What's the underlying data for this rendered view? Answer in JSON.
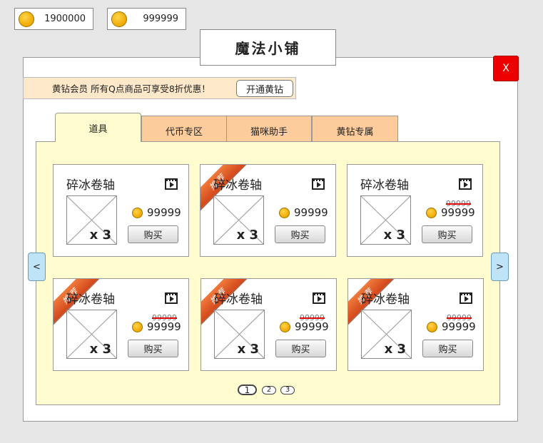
{
  "currency": [
    {
      "icon": "coin-icon",
      "amount": "1900000"
    },
    {
      "icon": "coin-icon",
      "amount": "999999"
    }
  ],
  "title": "魔法小铺",
  "close_label": "X",
  "vip_banner": {
    "text": "黄钻会员 所有Q点商品可享受8折优惠！",
    "button_label": "开通黄钻"
  },
  "tabs": [
    {
      "label": "道具",
      "active": true
    },
    {
      "label": "代币专区",
      "active": false
    },
    {
      "label": "猫咪助手",
      "active": false
    },
    {
      "label": "黄钻专属",
      "active": false
    }
  ],
  "items": [
    {
      "name": "碎冰卷轴",
      "quantity": "x 3",
      "price": "99999",
      "old_price": "",
      "badge": "",
      "buy_label": "购买"
    },
    {
      "name": "碎冰卷轴",
      "quantity": "x 3",
      "price": "99999",
      "old_price": "",
      "badge": "推荐",
      "buy_label": "购买"
    },
    {
      "name": "碎冰卷轴",
      "quantity": "x 3",
      "price": "99999",
      "old_price": "99999",
      "badge": "",
      "buy_label": "购买"
    },
    {
      "name": "碎冰卷轴",
      "quantity": "x 3",
      "price": "99999",
      "old_price": "99999",
      "badge": "推荐",
      "buy_label": "购买"
    },
    {
      "name": "碎冰卷轴",
      "quantity": "x 3",
      "price": "99999",
      "old_price": "99999",
      "badge": "推荐",
      "buy_label": "购买"
    },
    {
      "name": "碎冰卷轴",
      "quantity": "x 3",
      "price": "99999",
      "old_price": "99999",
      "badge": "推荐",
      "buy_label": "购买"
    }
  ],
  "nav": {
    "prev_label": "<",
    "next_label": ">"
  },
  "pagination": {
    "pages": [
      "1",
      "2",
      "3"
    ],
    "current": "1"
  },
  "colors": {
    "close": "#ee0000",
    "active_tab": "#fffdd0",
    "inactive_tab": "#fdcc9d",
    "vip_banner": "#fde9c9",
    "ribbon": "#e05a25",
    "strike": "#dd0000"
  }
}
